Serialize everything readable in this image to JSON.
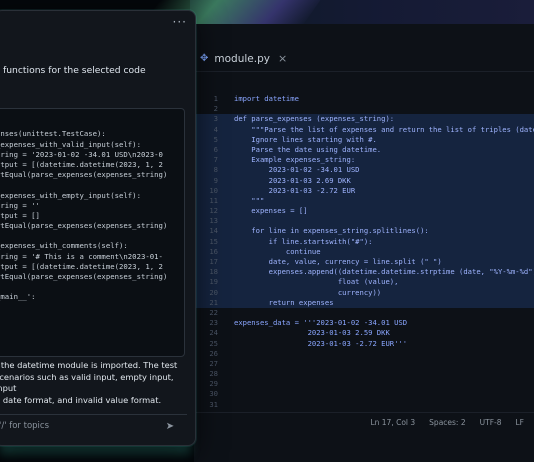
{
  "editor": {
    "tab": {
      "filename": "module.py",
      "close_glyph": "×",
      "icon": "python-file-icon"
    },
    "lines": [
      {
        "n": "1",
        "text": "import datetime",
        "hl": false
      },
      {
        "n": "2",
        "text": "",
        "hl": false
      },
      {
        "n": "3",
        "text": "def parse_expenses (expenses_string):",
        "hl": true
      },
      {
        "n": "4",
        "text": "    \"\"\"Parse the list of expenses and return the list of triples (date, v",
        "hl": true
      },
      {
        "n": "5",
        "text": "    Ignore lines starting with #.",
        "hl": true
      },
      {
        "n": "6",
        "text": "    Parse the date using datetime.",
        "hl": true
      },
      {
        "n": "7",
        "text": "    Example expenses_string:",
        "hl": true
      },
      {
        "n": "8",
        "text": "        2023-01-02 -34.01 USD",
        "hl": true
      },
      {
        "n": "9",
        "text": "        2023-01-03 2.69 DKK",
        "hl": true
      },
      {
        "n": "10",
        "text": "        2023-01-03 -2.72 EUR",
        "hl": true
      },
      {
        "n": "11",
        "text": "    \"\"\"",
        "hl": true
      },
      {
        "n": "12",
        "text": "    expenses = []",
        "hl": true
      },
      {
        "n": "13",
        "text": "",
        "hl": true
      },
      {
        "n": "14",
        "text": "    for line in expenses_string.splitlines():",
        "hl": true
      },
      {
        "n": "15",
        "text": "        if line.startswith(\"#\"):",
        "hl": true
      },
      {
        "n": "16",
        "text": "            continue",
        "hl": true
      },
      {
        "n": "17",
        "text": "        date, value, currency = line.split (\" \")",
        "hl": true
      },
      {
        "n": "18",
        "text": "        expenses.append((datetime.datetime.strptime (date, \"%Y-%m-%d\"),",
        "hl": true
      },
      {
        "n": "19",
        "text": "                        float (value),",
        "hl": true
      },
      {
        "n": "20",
        "text": "                        currency))",
        "hl": true
      },
      {
        "n": "21",
        "text": "        return expenses",
        "hl": true
      },
      {
        "n": "22",
        "text": "",
        "hl": false
      },
      {
        "n": "23",
        "text": "expenses_data = '''2023-01-02 -34.01 USD",
        "hl": false
      },
      {
        "n": "24",
        "text": "                 2023-01-03 2.59 DKK",
        "hl": false
      },
      {
        "n": "25",
        "text": "                 2023-01-03 -2.72 EUR'''",
        "hl": false
      },
      {
        "n": "26",
        "text": "",
        "hl": false
      },
      {
        "n": "27",
        "text": "",
        "hl": false
      },
      {
        "n": "28",
        "text": "",
        "hl": false
      },
      {
        "n": "29",
        "text": "",
        "hl": false
      },
      {
        "n": "30",
        "text": "",
        "hl": false
      },
      {
        "n": "31",
        "text": "",
        "hl": false
      }
    ],
    "status": {
      "position": "Ln 17, Col 3",
      "spaces": "Spaces: 2",
      "encoding": "UTF-8",
      "eol": "LF"
    }
  },
  "chat": {
    "menu": "···",
    "title": " functions for the selected code",
    "code_lines": [
      "",
      "",
      "enses(unittest.TestCase):",
      "_expenses_with_valid_input(self):",
      "tring = '2023-01-02 -34.01 USD\\n2023-0",
      "utput = [(datetime.datetime(2023, 1, 2",
      "rtEqual(parse_expenses(expenses_string)",
      "",
      "_expenses_with_empty_input(self):",
      "tring = ''",
      "utput = []",
      "rtEqual(parse_expenses(expenses_string)",
      "",
      "_expenses_with_comments(self):",
      "tring = '# This is a comment\\n2023-01-",
      "utput = [(datetime.datetime(2023, 1, 2",
      "rtEqual(parse_expenses(expenses_string)",
      "",
      "_main__':",
      ")",
      ""
    ],
    "message_lines": [
      "t the datetime module is imported. The test",
      "scenarios such as valid input, empty input, input",
      "d date format, and invalid value format."
    ],
    "input": {
      "placeholder": "'/' for topics",
      "send_glyph": "➤"
    }
  },
  "colors": {
    "accent": "#7aa2f7",
    "selection": "#15243f",
    "glow": "#50d2c8"
  }
}
